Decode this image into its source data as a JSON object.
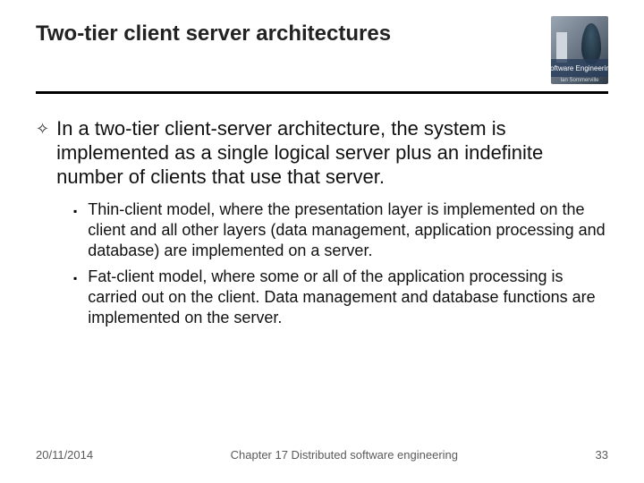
{
  "header": {
    "title": "Two-tier client server architectures",
    "logo": {
      "label": "Software Engineering",
      "sublabel": "Ian Sommerville"
    }
  },
  "content": {
    "main_bullet": "In a two-tier client-server architecture, the system is implemented as a single logical server plus an indefinite number of clients that use that server.",
    "sub_bullets": [
      "Thin-client model, where the presentation layer is implemented on the client and all other layers (data management, application processing and database) are implemented on a server.",
      "Fat-client model, where some or all of the application processing is carried out on the client. Data management and database functions are implemented on the server."
    ]
  },
  "footer": {
    "date": "20/11/2014",
    "chapter": "Chapter 17 Distributed software engineering",
    "page": "33"
  }
}
